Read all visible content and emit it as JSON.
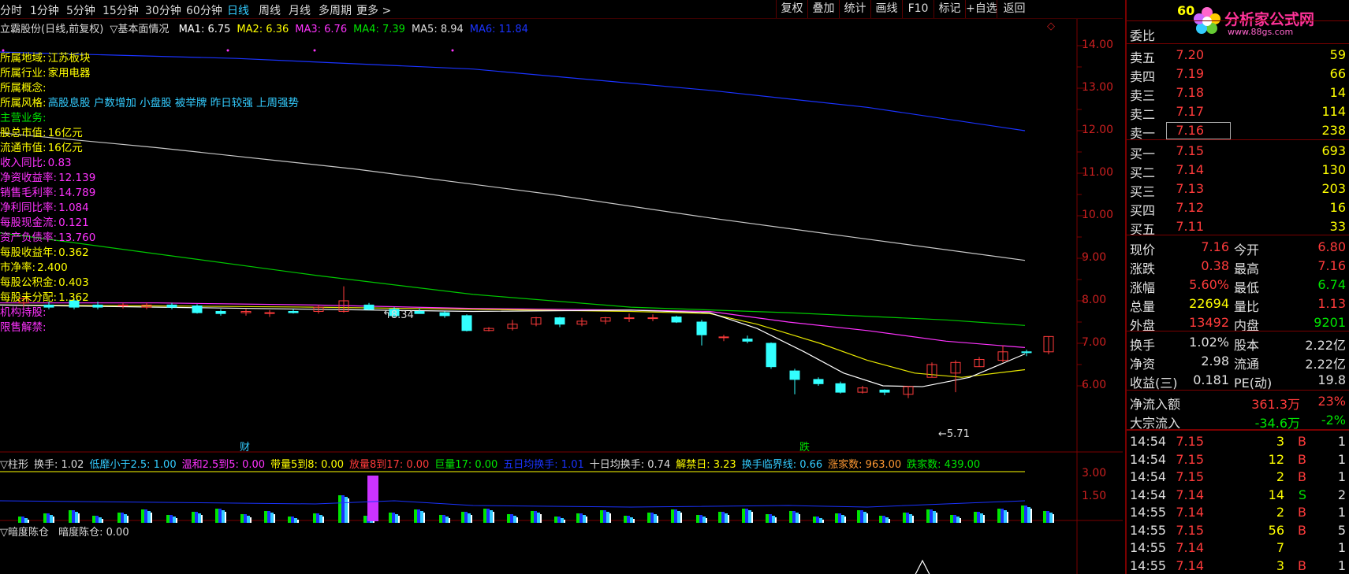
{
  "toolbar": {
    "periods": [
      "分时",
      "1分钟",
      "5分钟",
      "15分钟",
      "30分钟",
      "60分钟",
      "日线",
      "周线",
      "月线",
      "多周期",
      "更多 >"
    ],
    "active_period": "日线",
    "buttons": [
      "复权",
      "叠加",
      "统计",
      "画线",
      "F10",
      "标记",
      "+自选",
      "返回"
    ]
  },
  "header": {
    "stock": "立霸股份(日线,前复权)",
    "indicator": "▽基本面情况",
    "ma": [
      {
        "label": "MA1: 6.75",
        "color": "#ffffff"
      },
      {
        "label": "MA2: 6.36",
        "color": "#ffff00"
      },
      {
        "label": "MA3: 6.76",
        "color": "#ff33ff"
      },
      {
        "label": "MA4: 7.39",
        "color": "#00e600"
      },
      {
        "label": "MA5: 8.94",
        "color": "#dcdcdc"
      },
      {
        "label": "MA6: 11.84",
        "color": "#1a33ff"
      }
    ]
  },
  "fundamentals": [
    {
      "k": "所属地域:",
      "v": "江苏板块",
      "kc": "#ffff00",
      "vc": "#ffff00"
    },
    {
      "k": "所属行业:",
      "v": "家用电器",
      "kc": "#ffff00",
      "vc": "#ffff00"
    },
    {
      "k": "所属概念:",
      "v": "",
      "kc": "#ffff00",
      "vc": "#ffff00"
    },
    {
      "k": "所属风格:",
      "v": "高股息股 户数增加 小盘股 被举牌 昨日较强 上周强势",
      "kc": "#ffff00",
      "vc": "#33ccff"
    },
    {
      "k": "主营业务:",
      "v": "",
      "kc": "#00e600",
      "vc": "#00e600"
    },
    {
      "k": "股总市值:",
      "v": "16亿元",
      "kc": "#ffff00",
      "vc": "#ffff00"
    },
    {
      "k": "流通市值:",
      "v": "16亿元",
      "kc": "#ffff00",
      "vc": "#ffff00"
    },
    {
      "k": "收入同比:",
      "v": "0.83",
      "kc": "#ff33ff",
      "vc": "#ff33ff"
    },
    {
      "k": "净资收益率:",
      "v": "12.139",
      "kc": "#ff33ff",
      "vc": "#ff33ff"
    },
    {
      "k": "销售毛利率:",
      "v": "14.789",
      "kc": "#ff33ff",
      "vc": "#ff33ff"
    },
    {
      "k": "净利同比率:",
      "v": "1.084",
      "kc": "#ff33ff",
      "vc": "#ff33ff"
    },
    {
      "k": "每股现金流:",
      "v": "0.121",
      "kc": "#ff33ff",
      "vc": "#ff33ff"
    },
    {
      "k": "资产负债率:",
      "v": "13.760",
      "kc": "#ff33ff",
      "vc": "#ff33ff"
    },
    {
      "k": "每股收益年:",
      "v": "0.362",
      "kc": "#ffff00",
      "vc": "#ffff00"
    },
    {
      "k": "市净率:",
      "v": "2.400",
      "kc": "#ffff00",
      "vc": "#ffff00"
    },
    {
      "k": "每股公积金:",
      "v": "0.403",
      "kc": "#ffff00",
      "vc": "#ffff00"
    },
    {
      "k": "每股未分配:",
      "v": "1.362",
      "kc": "#ffff00",
      "vc": "#ffff00"
    },
    {
      "k": "机构持股:",
      "v": "",
      "kc": "#ff33ff",
      "vc": "#ff33ff"
    },
    {
      "k": "限售解禁:",
      "v": "",
      "kc": "#ff33ff",
      "vc": "#ff33ff"
    }
  ],
  "y_axis": [
    "14.00",
    "13.00",
    "12.00",
    "11.00",
    "10.00",
    "9.00",
    "8.00",
    "7.00",
    "6.00"
  ],
  "annotations": {
    "high": "8.34",
    "low": "5.71",
    "cai": "财",
    "die": "跌"
  },
  "vol_header": [
    {
      "t": "▽柱形",
      "c": "#dcdcdc"
    },
    {
      "t": "换手: 1.02",
      "c": "#dcdcdc"
    },
    {
      "t": "低靡小于2.5: 1.00",
      "c": "#33ccff"
    },
    {
      "t": "温和2.5到5: 0.00",
      "c": "#ff33ff"
    },
    {
      "t": "带量5到8: 0.00",
      "c": "#ffff00"
    },
    {
      "t": "放量8到17: 0.00",
      "c": "#ff3b3b"
    },
    {
      "t": "巨量17: 0.00",
      "c": "#00e600"
    },
    {
      "t": "五日均换手: 1.01",
      "c": "#1a33ff"
    },
    {
      "t": "十日均换手: 0.74",
      "c": "#dcdcdc"
    },
    {
      "t": "解禁日: 3.23",
      "c": "#ffff00"
    },
    {
      "t": "换手临界线: 0.66",
      "c": "#33ccff"
    },
    {
      "t": "涨家数: 963.00",
      "c": "#ff9933"
    },
    {
      "t": "跌家数: 439.00",
      "c": "#00e600"
    }
  ],
  "vol_axis": [
    "3.00",
    "1.50"
  ],
  "ind_header": {
    "a": "▽暗度陈仓",
    "b": "暗度陈仓: 0.00"
  },
  "panel": {
    "top_price": "60",
    "logo_text": "分析家公式网",
    "logo_url": "www.88gs.com",
    "weibi_label": "委比",
    "sells": [
      {
        "l": "卖五",
        "p": "7.20",
        "v": "59"
      },
      {
        "l": "卖四",
        "p": "7.19",
        "v": "66"
      },
      {
        "l": "卖三",
        "p": "7.18",
        "v": "14"
      },
      {
        "l": "卖二",
        "p": "7.17",
        "v": "114"
      },
      {
        "l": "卖一",
        "p": "7.16",
        "v": "238"
      }
    ],
    "buys": [
      {
        "l": "买一",
        "p": "7.15",
        "v": "693"
      },
      {
        "l": "买二",
        "p": "7.14",
        "v": "130"
      },
      {
        "l": "买三",
        "p": "7.13",
        "v": "203"
      },
      {
        "l": "买四",
        "p": "7.12",
        "v": "16"
      },
      {
        "l": "买五",
        "p": "7.11",
        "v": "33"
      }
    ],
    "quote": [
      {
        "l1": "现价",
        "v1": "7.16",
        "c1": "red",
        "l2": "今开",
        "v2": "6.80",
        "c2": "red"
      },
      {
        "l1": "涨跌",
        "v1": "0.38",
        "c1": "red",
        "l2": "最高",
        "v2": "7.16",
        "c2": "red"
      },
      {
        "l1": "涨幅",
        "v1": "5.60%",
        "c1": "red",
        "l2": "最低",
        "v2": "6.74",
        "c2": "green"
      },
      {
        "l1": "总量",
        "v1": "22694",
        "c1": "yel",
        "l2": "量比",
        "v2": "1.13",
        "c2": "red"
      },
      {
        "l1": "外盘",
        "v1": "13492",
        "c1": "red",
        "l2": "内盘",
        "v2": "9201",
        "c2": "green"
      }
    ],
    "shares": [
      {
        "l1": "换手",
        "v1": "1.02%",
        "l2": "股本",
        "v2": "2.22亿"
      },
      {
        "l1": "净资",
        "v1": "2.98",
        "l2": "流通",
        "v2": "2.22亿"
      },
      {
        "l1": "收益(三)",
        "v1": "0.181",
        "l2": "PE(动)",
        "v2": "19.8"
      }
    ],
    "flow": [
      {
        "l": "净流入额",
        "v": "361.3万",
        "p": "23%",
        "c": "red"
      },
      {
        "l": "大宗流入",
        "v": "-34.6万",
        "p": "-2%",
        "c": "green"
      }
    ],
    "ticks": [
      {
        "t": "14:54",
        "p": "7.15",
        "v": "3",
        "d": "B",
        "n": "1"
      },
      {
        "t": "14:54",
        "p": "7.15",
        "v": "12",
        "d": "B",
        "n": "1"
      },
      {
        "t": "14:54",
        "p": "7.15",
        "v": "2",
        "d": "B",
        "n": "1"
      },
      {
        "t": "14:54",
        "p": "7.14",
        "v": "14",
        "d": "S",
        "n": "2"
      },
      {
        "t": "14:55",
        "p": "7.14",
        "v": "2",
        "d": "B",
        "n": "1"
      },
      {
        "t": "14:55",
        "p": "7.15",
        "v": "56",
        "d": "B",
        "n": "5"
      },
      {
        "t": "14:55",
        "p": "7.14",
        "v": "7",
        "d": "",
        "n": "1"
      },
      {
        "t": "14:55",
        "p": "7.14",
        "v": "3",
        "d": "B",
        "n": "1"
      }
    ]
  }
}
